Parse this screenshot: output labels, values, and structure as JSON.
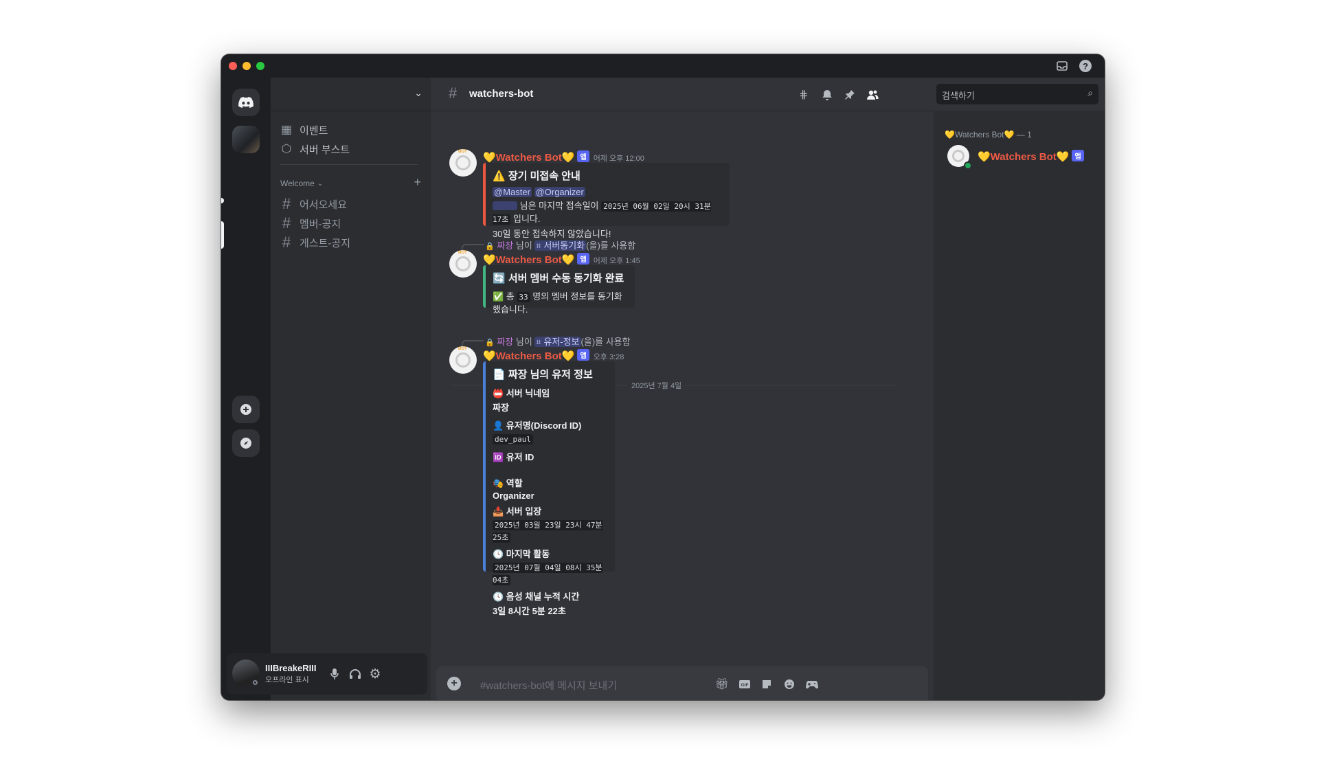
{
  "app": {
    "colors": {
      "accent": "#5865f2",
      "bot_name": "#ed5a45",
      "online": "#23a55a",
      "embed_warn": "#e8573e",
      "embed_ok": "#43b581",
      "embed_info": "#4a7fd9"
    }
  },
  "titlebar": {
    "inbox_icon": "inbox-icon",
    "help_icon": "help-icon"
  },
  "sidebar": {
    "nav": [
      {
        "icon": "calendar-icon",
        "label": "이벤트"
      },
      {
        "icon": "boost-icon",
        "label": "서버 부스트"
      }
    ],
    "category": "Welcome",
    "channels": [
      {
        "label": "어서오세요"
      },
      {
        "label": "멤버-공지"
      },
      {
        "label": "게스트-공지"
      }
    ]
  },
  "user_panel": {
    "name": "IIIBreakeRIII",
    "status": "오프라인 표시"
  },
  "channel": {
    "name": "watchers-bot",
    "search_placeholder": "검색하기"
  },
  "messages": {
    "m1": {
      "author": "💛Watchers Bot💛",
      "badge": "앱",
      "time": "어제 오후 12:00",
      "embed_title": "⚠️ 장기 미접속 안내",
      "mention1": "@Master",
      "mention2": "@Organizer",
      "line1_pre": "님은 마지막 접속일이",
      "line1_code": "2025년 06월 02일 20시 31분 17초",
      "line1_post": "입니다.",
      "line2": "30일 동안 접속하지 않았습니다!"
    },
    "m2": {
      "reply_user": "짜장",
      "reply_mid": "님이",
      "reply_cmd": "⌗ 서버동기화",
      "reply_post": "(을)를 사용함",
      "author": "💛Watchers Bot💛",
      "badge": "앱",
      "time": "어제 오후 1:45",
      "embed_title": "🔄 서버 멤버 수동 동기화 완료",
      "line_pre": "✅ 총",
      "line_code": "33",
      "line_post": "명의 멤버 정보를 동기화했습니다."
    },
    "date_divider": "2025년 7월 4일",
    "m3": {
      "reply_user": "짜장",
      "reply_mid": "님이",
      "reply_cmd": "⌗ 유저-정보",
      "reply_post": "(을)를 사용함",
      "author": "💛Watchers Bot💛",
      "badge": "앱",
      "time": "오후 3:28",
      "embed_title": "📄 짜장 님의 유저 정보",
      "fields": [
        {
          "name": "📛 서버 닉네임",
          "value": "짜장"
        },
        {
          "name": "👤 유저명(Discord ID)",
          "value": "dev_paul"
        },
        {
          "name": "🆔 유저 ID",
          "value": ""
        },
        {
          "name": "🎭 역할",
          "value": "Organizer"
        },
        {
          "name": "📥 서버 입장",
          "value": "2025년 03월 23일 23시 47분 25초"
        },
        {
          "name": "🕓 마지막 활동",
          "value": "2025년 07월 04일 08시 35분 04초"
        },
        {
          "name": "🕓 음성 채널 누적 시간",
          "value": "3일 8시간 5분 22초"
        }
      ]
    }
  },
  "composer": {
    "placeholder": "#watchers-bot에 메시지 보내기"
  },
  "members": {
    "category": "💛Watchers Bot💛 — 1",
    "list": [
      {
        "name": "💛Watchers Bot💛",
        "badge": "앱",
        "status": "online"
      }
    ]
  }
}
